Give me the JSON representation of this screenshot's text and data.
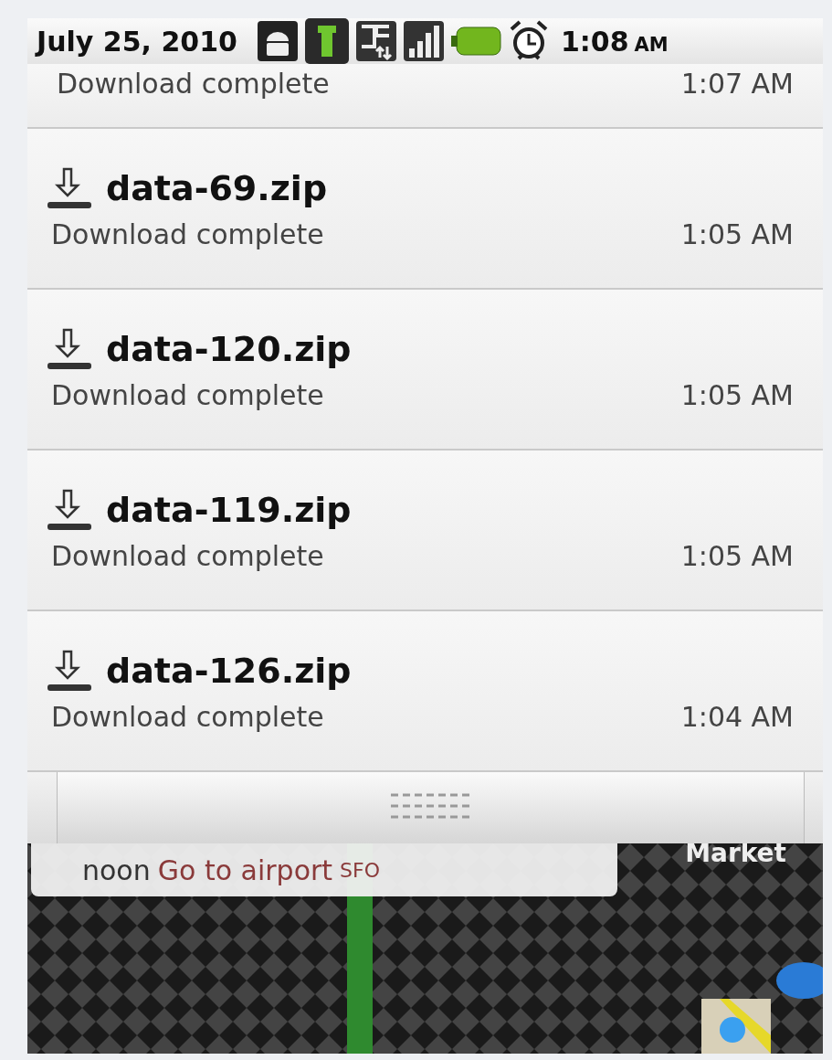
{
  "status_bar": {
    "date": "July 25, 2010",
    "time": "1:08",
    "ampm": "AM"
  },
  "notifications": [
    {
      "status": "Download complete",
      "time": "1:07 AM"
    },
    {
      "title": "data-69.zip",
      "status": "Download complete",
      "time": "1:05 AM"
    },
    {
      "title": "data-120.zip",
      "status": "Download complete",
      "time": "1:05 AM"
    },
    {
      "title": "data-119.zip",
      "status": "Download complete",
      "time": "1:05 AM"
    },
    {
      "title": "data-126.zip",
      "status": "Download complete",
      "time": "1:04 AM"
    }
  ],
  "home": {
    "agenda": {
      "when": "noon",
      "title": "Go to airport",
      "place": "SFO"
    },
    "shortcut_label": "Market"
  }
}
